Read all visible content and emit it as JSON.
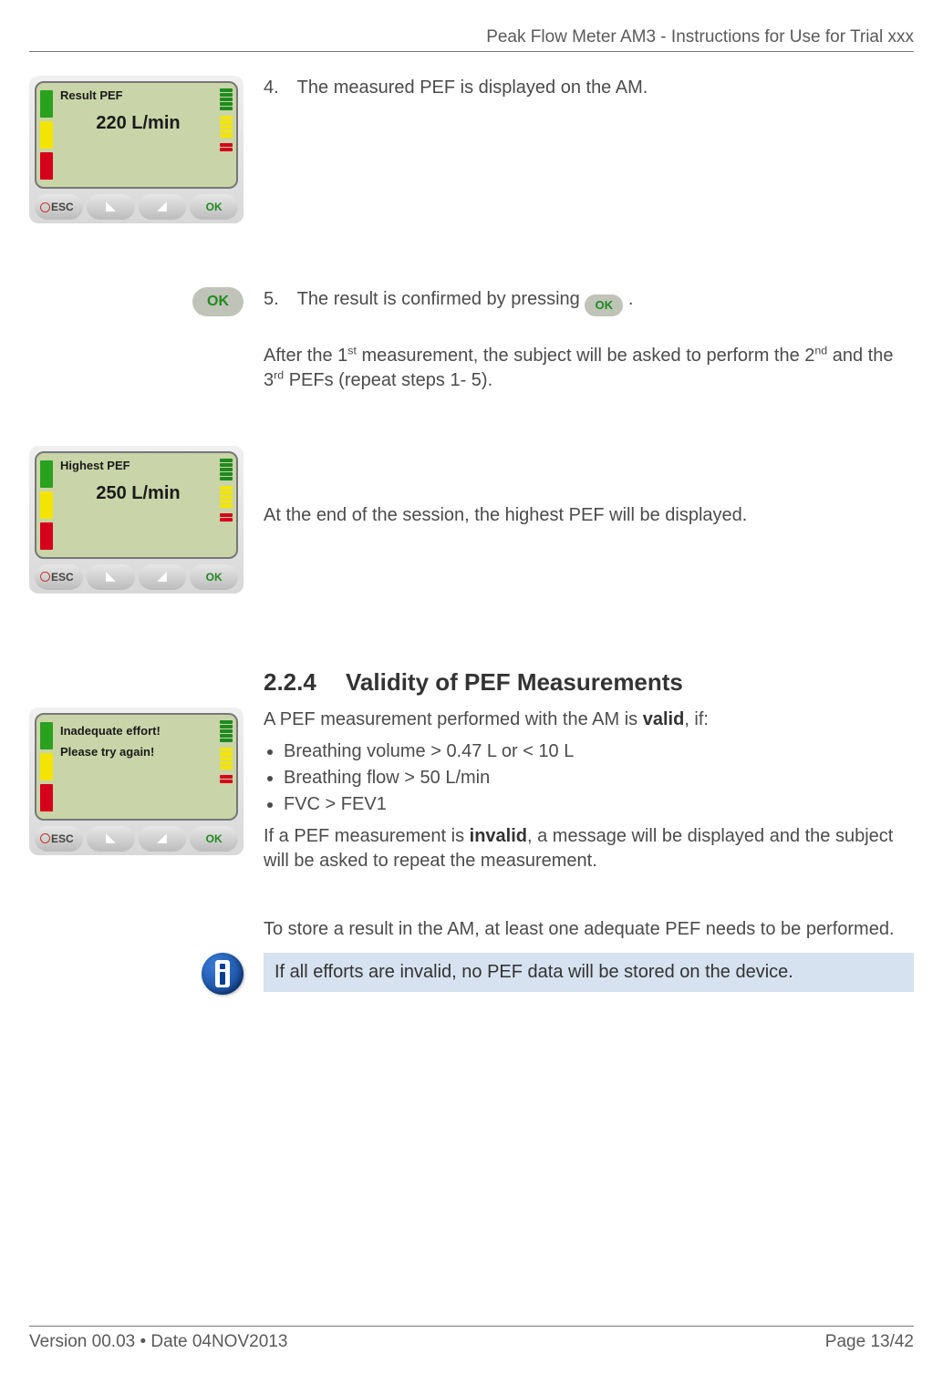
{
  "header": {
    "running": "Peak Flow Meter AM3 - Instructions for Use for Trial xxx"
  },
  "step4": {
    "device": {
      "title": "Result PEF",
      "value": "220 L/min"
    },
    "text": "4. The measured PEF is displayed on the AM."
  },
  "step5": {
    "ok_label": "OK",
    "line_a": "5. The result is confirmed by pressing ",
    "ok_inline": "OK",
    "line_b": " .",
    "after_a": "After the 1",
    "after_sup1": "st",
    "after_b": " measurement, the subject will be asked to perform the 2",
    "after_sup2": "nd",
    "after_c": " and the 3",
    "after_sup3": "rd",
    "after_d": " PEFs (repeat steps 1- 5)."
  },
  "highest": {
    "device": {
      "title": "Highest PEF",
      "value": "250 L/min"
    },
    "text": "At the end of the session, the highest PEF will be displayed."
  },
  "section": {
    "num": "2.2.4",
    "title": "Validity of PEF Measurements",
    "intro_a": "A PEF measurement performed with the AM is ",
    "intro_bold": "valid",
    "intro_b": ", if:",
    "bullets": [
      "Breathing volume > 0.47 L or < 10 L",
      "Breathing flow > 50 L/min",
      "FVC > FEV1"
    ],
    "invalid_a": "If a PEF measurement is ",
    "invalid_bold": "invalid",
    "invalid_b": ", a message will be displayed and the subject will be asked to repeat the measurement.",
    "device": {
      "line1": "Inadequate effort!",
      "line2": "Please try again!"
    },
    "store": "To store a result in the AM, at least one adequate PEF needs to be performed.",
    "note": "If all efforts are invalid, no PEF data will be stored on the device."
  },
  "keys": {
    "esc": "ESC",
    "ok": "OK"
  },
  "footer": {
    "left": "Version 00.03 • Date 04NOV2013",
    "right": "Page 13/42"
  }
}
